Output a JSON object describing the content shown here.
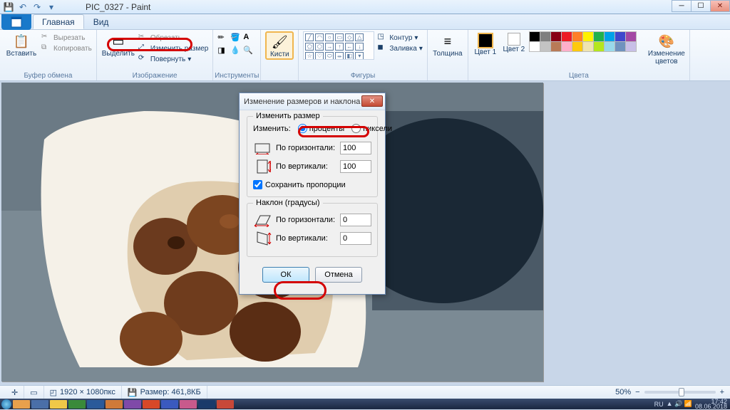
{
  "window": {
    "title": "PIC_0327 - Paint"
  },
  "tabs": {
    "home": "Главная",
    "view": "Вид"
  },
  "groups": {
    "clipboard": {
      "label": "Буфер обмена",
      "paste": "Вставить",
      "cut": "Вырезать",
      "copy": "Копировать"
    },
    "image": {
      "label": "Изображение",
      "select": "Выделить",
      "crop": "Обрезать",
      "resize": "Изменить размер",
      "rotate": "Повернуть"
    },
    "tools": {
      "label": "Инструменты"
    },
    "brushes": {
      "label": "Кисти"
    },
    "shapes": {
      "label": "Фигуры",
      "outline": "Контур",
      "fill": "Заливка"
    },
    "size": {
      "label": "Толщина"
    },
    "colors": {
      "label": "Цвета",
      "color1": "Цвет 1",
      "color2": "Цвет 2",
      "edit": "Изменение цветов"
    }
  },
  "palette_row1": [
    "#000000",
    "#7f7f7f",
    "#880015",
    "#ed1c24",
    "#ff7f27",
    "#fff200",
    "#22b14c",
    "#00a2e8",
    "#3f48cc",
    "#a349a4"
  ],
  "palette_row2": [
    "#ffffff",
    "#c3c3c3",
    "#b97a57",
    "#ffaec9",
    "#ffc90e",
    "#efe4b0",
    "#b5e61d",
    "#99d9ea",
    "#7092be",
    "#c8bfe7"
  ],
  "dialog": {
    "title": "Изменение размеров и наклона",
    "resize_legend": "Изменить размер",
    "change_label": "Изменить:",
    "percent": "проценты",
    "pixels": "пиксели",
    "horizontal": "По горизонтали:",
    "vertical": "По вертикали:",
    "h_value": "100",
    "v_value": "100",
    "keep_ratio": "Сохранить пропорции",
    "skew_legend": "Наклон (градусы)",
    "skew_h": "0",
    "skew_v": "0",
    "ok": "ОК",
    "cancel": "Отмена"
  },
  "status": {
    "dimensions": "1920 × 1080пкс",
    "filesize": "Размер: 461,8КБ",
    "zoom": "50%"
  },
  "tray": {
    "lang": "RU",
    "time": "17:42",
    "date": "08.06.2018"
  }
}
